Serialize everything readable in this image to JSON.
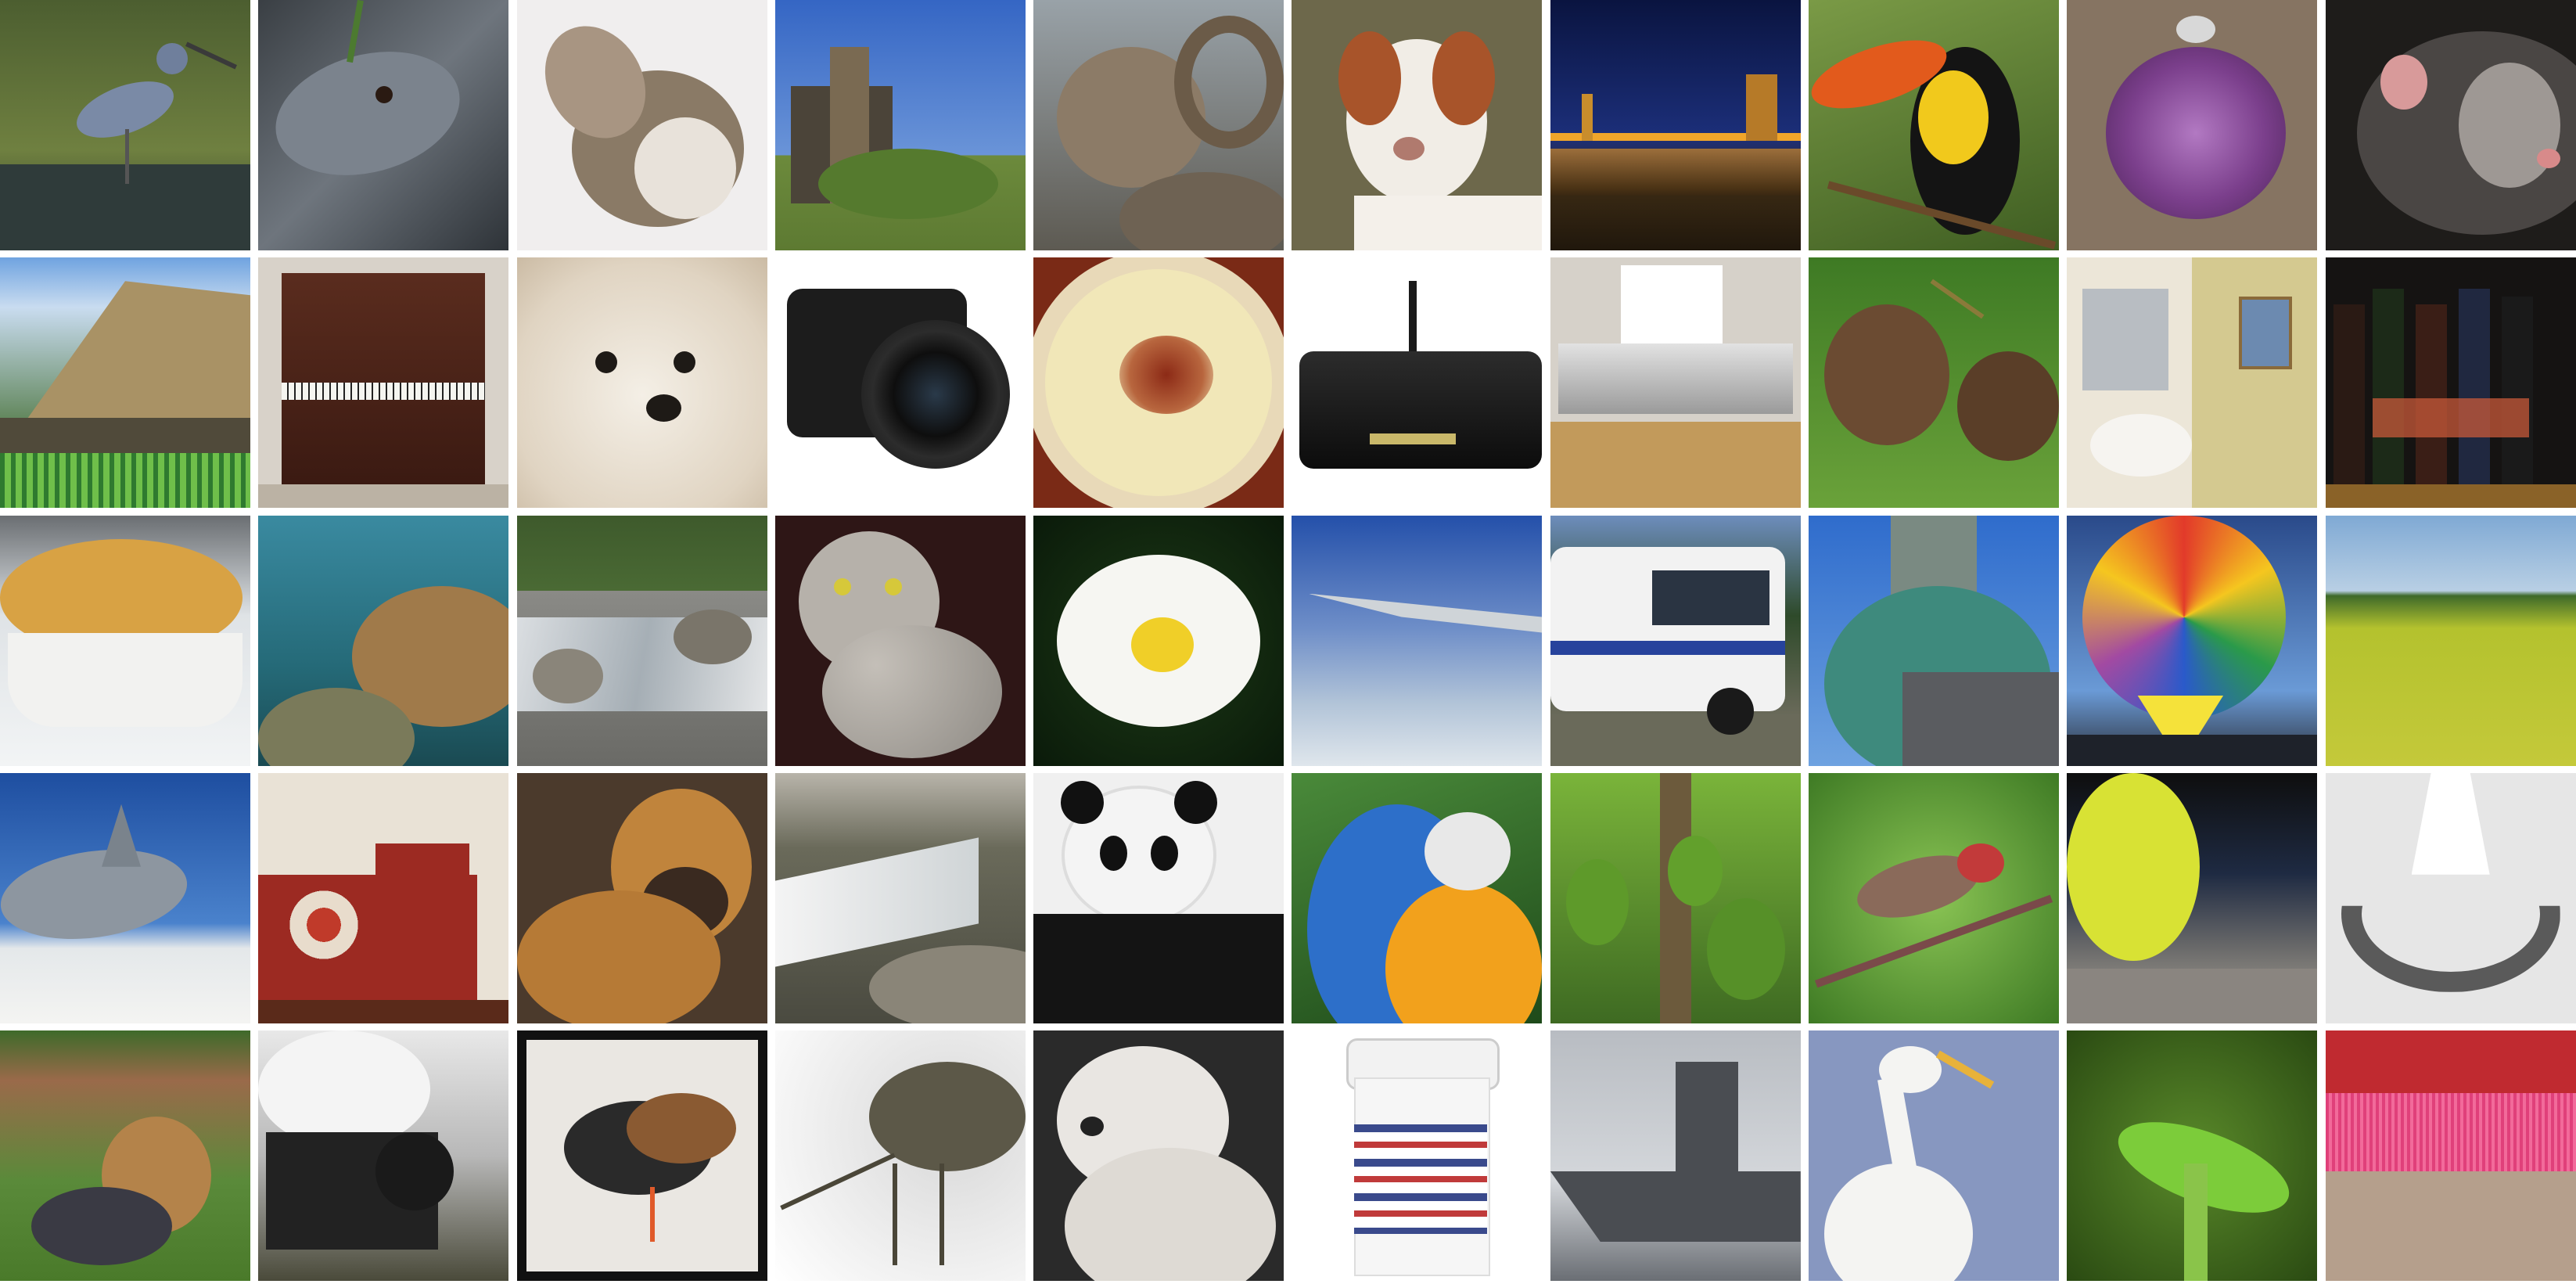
{
  "image": {
    "kind": "sample-grid",
    "rows": 5,
    "columns": 10,
    "tiles": [
      {
        "subject": "little-blue-heron-by-water",
        "colors": [
          "#5b6b3a",
          "#7f8fa4"
        ]
      },
      {
        "subject": "snake-head-closeup",
        "colors": [
          "#4a5058",
          "#8a919a"
        ]
      },
      {
        "subject": "howling-wolf",
        "colors": [
          "#eceaea",
          "#8b7c6a"
        ]
      },
      {
        "subject": "castle-ruin-tower",
        "colors": [
          "#3f6ec8",
          "#6c8a3c"
        ]
      },
      {
        "subject": "bighorn-ram",
        "colors": [
          "#8c7d6b",
          "#5a4c3e"
        ]
      },
      {
        "subject": "brittany-spaniel-dog",
        "colors": [
          "#6e6a4e",
          "#a8542a"
        ]
      },
      {
        "subject": "suspension-bridge-at-night",
        "colors": [
          "#0d1a4a",
          "#e59a2a"
        ]
      },
      {
        "subject": "toucan",
        "colors": [
          "#6d8a3e",
          "#f1c91c"
        ]
      },
      {
        "subject": "sea-urchin",
        "colors": [
          "#7d6b56",
          "#7b3f8c"
        ]
      },
      {
        "subject": "ferret",
        "colors": [
          "#3d3a38",
          "#8d8884"
        ]
      },
      {
        "subject": "thatched-roof-house",
        "colors": [
          "#a89064",
          "#3f6a2a"
        ]
      },
      {
        "subject": "upright-piano",
        "colors": [
          "#4a241a",
          "#cfc8c0"
        ]
      },
      {
        "subject": "maltese-dog-closeup",
        "colors": [
          "#ede7dd",
          "#d6cbb9"
        ]
      },
      {
        "subject": "slr-camera",
        "colors": [
          "#ffffff",
          "#1b1b1b"
        ]
      },
      {
        "subject": "bowl-of-soup",
        "colors": [
          "#f1e6b0",
          "#9c3a1e"
        ]
      },
      {
        "subject": "black-router-modem",
        "colors": [
          "#ffffff",
          "#141414"
        ]
      },
      {
        "subject": "printer-on-cabinet",
        "colors": [
          "#d9d4cd",
          "#c29a5b"
        ]
      },
      {
        "subject": "limpkin-birds",
        "colors": [
          "#3e6a24",
          "#6b4b32"
        ]
      },
      {
        "subject": "bathroom-sink",
        "colors": [
          "#d8cc96",
          "#f0ece5"
        ]
      },
      {
        "subject": "bottles-on-shelf",
        "colors": [
          "#141414",
          "#8a6228"
        ]
      },
      {
        "subject": "pot-pie-dish",
        "colors": [
          "#dcb04a",
          "#e9eef2"
        ]
      },
      {
        "subject": "coral-reef-underwater",
        "colors": [
          "#2f7a8a",
          "#b88a52"
        ]
      },
      {
        "subject": "mountain-stream-rocks",
        "colors": [
          "#3e5a2c",
          "#c5ccd2"
        ]
      },
      {
        "subject": "spotted-cat",
        "colors": [
          "#3a1c1c",
          "#b2aea7"
        ]
      },
      {
        "subject": "white-daisy",
        "colors": [
          "#0f2a0f",
          "#f0cf28"
        ]
      },
      {
        "subject": "airplane-wing-in-sky",
        "colors": [
          "#2b55b0",
          "#c9d3dc"
        ]
      },
      {
        "subject": "white-camper-van",
        "colors": [
          "#f2f2f2",
          "#27439c"
        ]
      },
      {
        "subject": "green-dome-building",
        "colors": [
          "#3b7ccf",
          "#3e8a7d"
        ]
      },
      {
        "subject": "hot-air-balloon",
        "colors": [
          "#f5c61f",
          "#2e4f8a"
        ]
      },
      {
        "subject": "canola-field",
        "colors": [
          "#7fa9d4",
          "#c4c93a"
        ]
      },
      {
        "subject": "shark-underwater",
        "colors": [
          "#2d63b2",
          "#8d96a0"
        ]
      },
      {
        "subject": "bedroom-quilt",
        "colors": [
          "#9c2a22",
          "#e9e2d6"
        ]
      },
      {
        "subject": "boxer-dog",
        "colors": [
          "#c0843c",
          "#4b3a2c"
        ]
      },
      {
        "subject": "dam-waterfall",
        "colors": [
          "#b5b0a5",
          "#f2f2f2"
        ]
      },
      {
        "subject": "giant-panda",
        "colors": [
          "#111111",
          "#f0f0f0"
        ]
      },
      {
        "subject": "macaw-parrot",
        "colors": [
          "#2d6fc9",
          "#f2a11c"
        ]
      },
      {
        "subject": "jackfruit-tree",
        "colors": [
          "#5a8c2a",
          "#6c5a3c"
        ]
      },
      {
        "subject": "house-finch-on-branch",
        "colors": [
          "#78b44a",
          "#b23a3a"
        ]
      },
      {
        "subject": "tennis-ball",
        "colors": [
          "#d8e234",
          "#2c3a52"
        ]
      },
      {
        "subject": "necklace-on-stand",
        "colors": [
          "#eeeeee",
          "#5a5a5a"
        ]
      },
      {
        "subject": "yorkshire-terrier-on-grass",
        "colors": [
          "#5a8a3a",
          "#b4834a"
        ]
      },
      {
        "subject": "steam-locomotive",
        "colors": [
          "#d8d8d8",
          "#222222"
        ]
      },
      {
        "subject": "ruddy-turnstone-bird",
        "colors": [
          "#111111",
          "#eae7e2"
        ]
      },
      {
        "subject": "weevil-beetle-macro",
        "colors": [
          "#ffffff",
          "#5c5848"
        ]
      },
      {
        "subject": "white-terrier-dog",
        "colors": [
          "#2a2a2a",
          "#e9e6e2"
        ]
      },
      {
        "subject": "pill-bottle",
        "colors": [
          "#ffffff",
          "#3a4a8c"
        ]
      },
      {
        "subject": "aircraft-carrier",
        "colors": [
          "#c9ccd1",
          "#4a4d52"
        ]
      },
      {
        "subject": "white-egret",
        "colors": [
          "#8797c0",
          "#f4f4f2"
        ]
      },
      {
        "subject": "green-lizard-anole",
        "colors": [
          "#3b6e1f",
          "#7ccc3a"
        ]
      },
      {
        "subject": "red-broom-bristles",
        "colors": [
          "#b59f8c",
          "#e0407a"
        ]
      }
    ]
  }
}
